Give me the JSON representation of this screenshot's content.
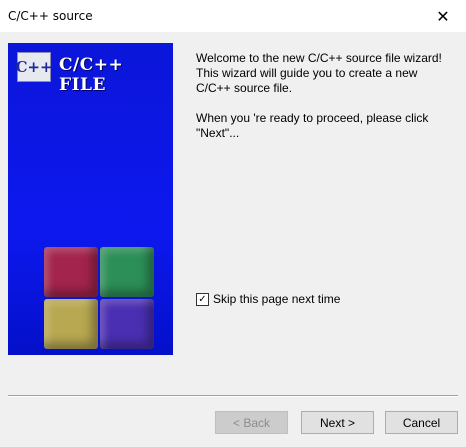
{
  "window": {
    "title": "C/C++ source",
    "close_glyph": "✕"
  },
  "banner": {
    "logo_text": "C++",
    "title": "C/C++ FILE"
  },
  "content": {
    "welcome": "Welcome to the new C/C++ source file wizard!\nThis wizard will guide you to create a new\nC/C++ source file.",
    "instruction": "When you 're ready to proceed, please click\n\"Next\"..."
  },
  "options": {
    "skip_label": "Skip this page next time",
    "skip_checked": true,
    "check_glyph": "✓"
  },
  "buttons": {
    "back": "< Back",
    "next": "Next >",
    "cancel": "Cancel"
  }
}
